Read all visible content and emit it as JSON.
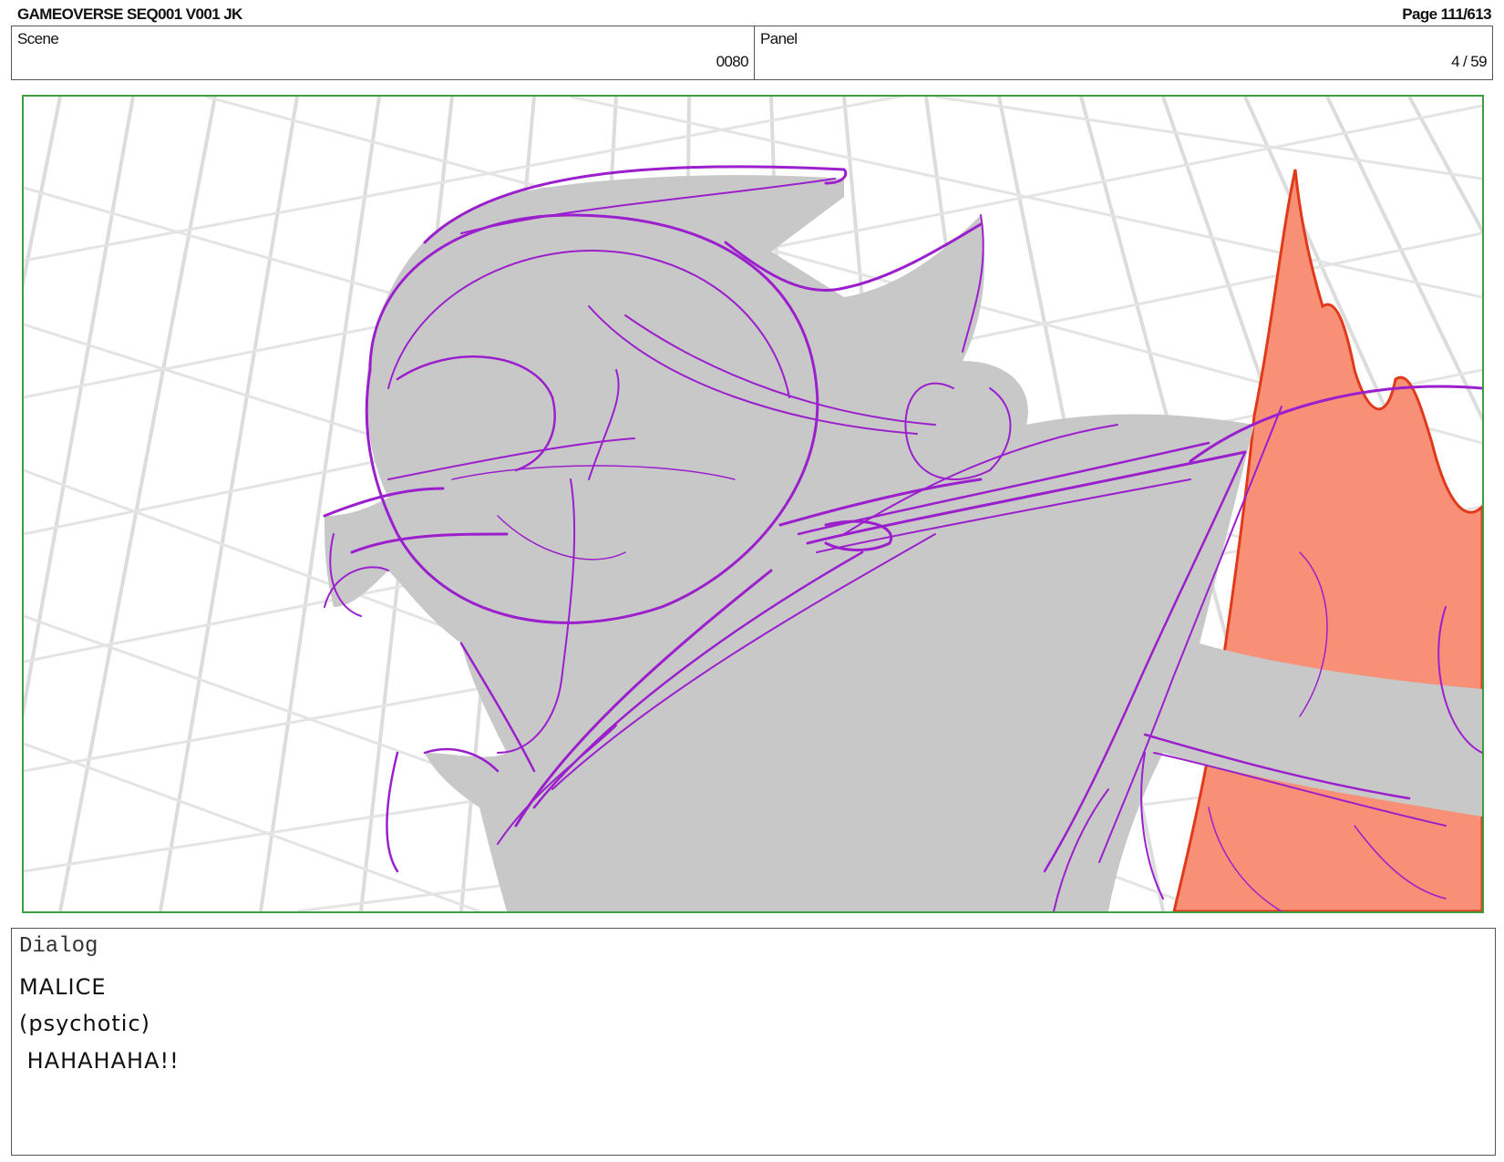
{
  "header": {
    "title": "GAMEOVERSE SEQ001 V001 JK",
    "page": "Page 111/613"
  },
  "info": {
    "scene_label": "Scene",
    "scene_value": "0080",
    "panel_label": "Panel",
    "panel_value": "4 / 59"
  },
  "panel_image": {
    "description_icon": "storyboard-sketch",
    "colors": {
      "frame_border": "#3f9d3f",
      "sketch_line": "#9b1fcc",
      "character_fill": "#c8c8c8",
      "fire_fill": "#f79077",
      "fire_line": "#e03a1a",
      "grid": "#d9d9d9"
    }
  },
  "dialog": {
    "title": "Dialog",
    "lines": [
      "MALICE",
      "(psychotic)",
      " HAHAHAHA!!"
    ]
  }
}
